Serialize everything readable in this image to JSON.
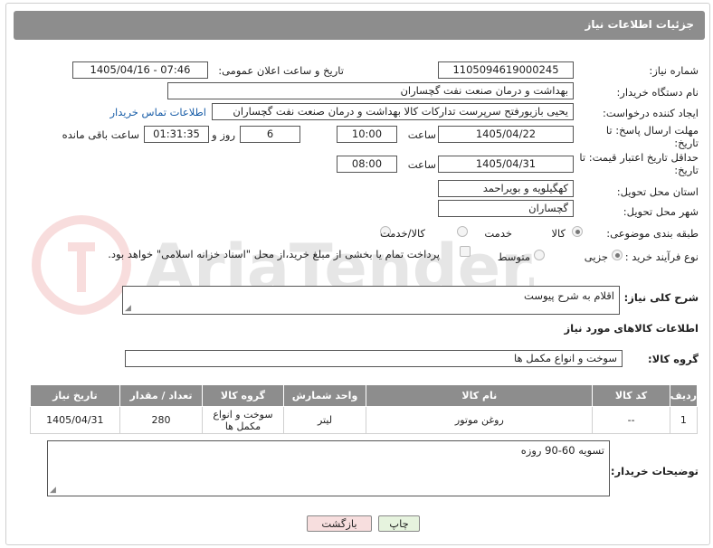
{
  "header": {
    "title": "جزئیات اطلاعات نیاز"
  },
  "fields": {
    "need_number_label": "شماره نیاز:",
    "need_number": "1105094619000245",
    "announce_label": "تاریخ و ساعت اعلان عمومی:",
    "announce_value": "1405/04/16 - 07:46",
    "buyer_org_label": "نام دستگاه خریدار:",
    "buyer_org": "بهداشت و درمان صنعت نفت گچساران",
    "creator_label": "ایجاد کننده درخواست:",
    "creator": "یحیی بازیورفتح سرپرست تدارکات کالا  بهداشت و درمان صنعت نفت گچساران",
    "contact_link": "اطلاعات تماس خریدار",
    "reply_deadline_label": "مهلت ارسال پاسخ: تا تاریخ:",
    "reply_date": "1405/04/22",
    "time_label": "ساعت",
    "reply_time": "10:00",
    "days_value": "6",
    "days_label": "روز و",
    "remaining_time": "01:31:35",
    "remaining_label": "ساعت باقی مانده",
    "price_validity_label": "حداقل تاریخ اعتبار قیمت: تا تاریخ:",
    "price_date": "1405/04/31",
    "price_time": "08:00",
    "province_label": "استان محل تحویل:",
    "province": "کهگیلویه و بویراحمد",
    "city_label": "شهر محل تحویل:",
    "city": "گچساران",
    "category_label": "طبقه بندی موضوعی:",
    "category_options": [
      "کالا",
      "خدمت",
      "کالا/خدمت"
    ],
    "process_label": "نوع فرآیند خرید :",
    "process_options": [
      "جزیی",
      "متوسط"
    ],
    "payment_note": "پرداخت تمام یا بخشی از مبلغ خرید،از محل \"اسناد خزانه اسلامی\" خواهد بود."
  },
  "description": {
    "label": "شرح کلی نیاز:",
    "value": "اقلام به شرح پیوست"
  },
  "goods_section": {
    "title": "اطلاعات کالاهای مورد نیاز",
    "group_label": "گروه کالا:",
    "group_value": "سوخت و انواع مکمل ها"
  },
  "table": {
    "headers": [
      "ردیف",
      "کد کالا",
      "نام کالا",
      "واحد شمارش",
      "گروه کالا",
      "تعداد / مقدار",
      "تاریخ نیاز"
    ],
    "rows": [
      [
        "1",
        "--",
        "روغن موتور",
        "لیتر",
        "سوخت و انواع مکمل ها",
        "280",
        "1405/04/31"
      ]
    ]
  },
  "buyer_notes": {
    "label": "توضیحات خریدار:",
    "value": "تسویه 60-90 روزه"
  },
  "buttons": {
    "print": "چاپ",
    "back": "بازگشت"
  },
  "watermark_text": "AriaTender.neT",
  "colors": {
    "header_bg": "#8d8d8d",
    "link": "#1a5ea8",
    "back_btn": "#f7dede",
    "print_btn": "#e6f3de"
  }
}
